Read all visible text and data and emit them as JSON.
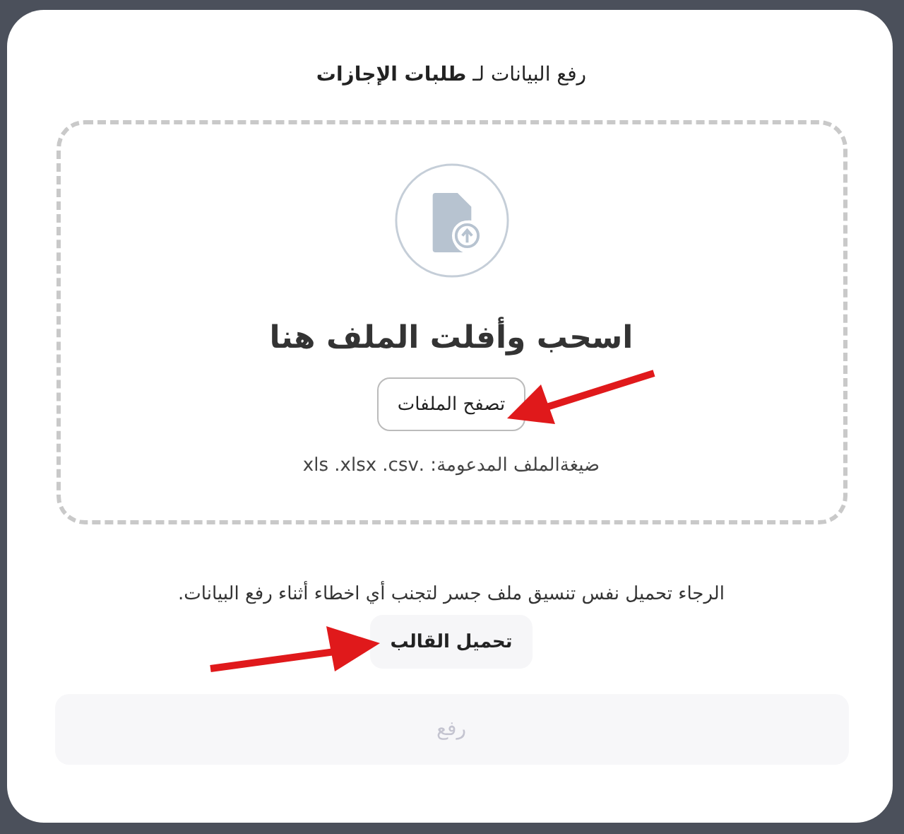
{
  "dialog": {
    "title": "رفع البيانات لـ **طلبات الإجازات**",
    "dropzone": {
      "heading": "اسحب وأفلت الملف هنا",
      "browse_button": "تصفح الملفات",
      "formats": "ضيغةالملف المدعومة: .xls .xlsx .csv"
    },
    "note": "الرجاء تحميل نفس تنسيق ملف جسر لتجنب أي اخطاء أثناء رفع البيانات.",
    "template_button": "تحميل القالب",
    "upload_button": {
      "label": "رفع",
      "disabled": true
    }
  }
}
